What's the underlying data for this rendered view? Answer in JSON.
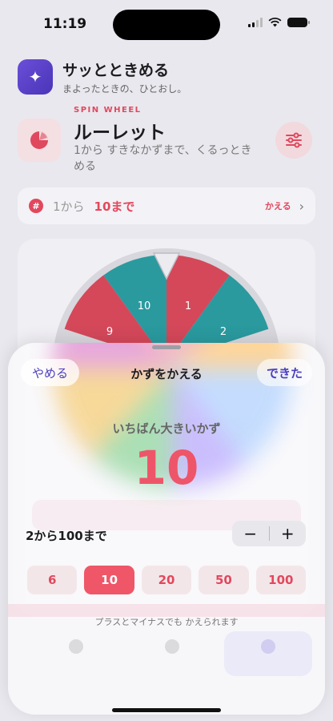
{
  "status": {
    "time": "11:19"
  },
  "app": {
    "title": "サッとときめる",
    "subtitle": "まよったときの、ひとおし。",
    "icon": "sparkles-icon"
  },
  "mode": {
    "eyebrow": "SPIN WHEEL",
    "title": "ルーレット",
    "description": "1から すきなかずまで、くるっときめる",
    "icon": "pie-chart-icon",
    "settings_icon": "sliders-icon"
  },
  "range": {
    "from": "1から",
    "to": "10まで",
    "change_label": "かえる",
    "icon": "hash-icon"
  },
  "wheel": {
    "visible_labels": [
      "10",
      "1",
      "2",
      "9"
    ],
    "colors": {
      "red": "#d4485a",
      "teal": "#2a9a9f"
    }
  },
  "sheet": {
    "cancel_label": "やめる",
    "title": "かずをかえる",
    "done_label": "できた",
    "max_label": "いちばん大きいかず",
    "max_value": "10",
    "range_text": "2から100まで",
    "stepper": {
      "minus": "−",
      "plus": "+"
    },
    "presets": [
      {
        "label": "6",
        "active": false
      },
      {
        "label": "10",
        "active": true
      },
      {
        "label": "20",
        "active": false
      },
      {
        "label": "50",
        "active": false
      },
      {
        "label": "100",
        "active": false
      }
    ],
    "hint": "プラスとマイナスでも かえられます"
  },
  "colors": {
    "accent": "#e2485d",
    "purple": "#4b3fc0"
  }
}
